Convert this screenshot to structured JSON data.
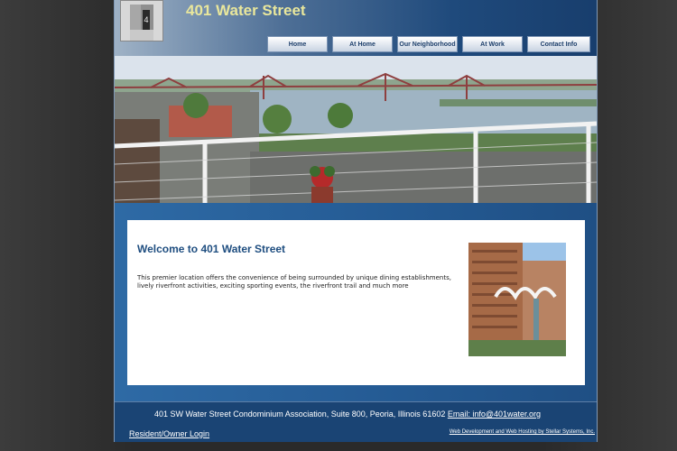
{
  "header": {
    "title": "401 Water Street",
    "logo_icon": "building-tower-icon"
  },
  "nav": {
    "items": [
      {
        "label": "Home"
      },
      {
        "label": "At Home"
      },
      {
        "label": "Our Neighborhood"
      },
      {
        "label": "At Work"
      },
      {
        "label": "Contact Info"
      }
    ]
  },
  "hero": {
    "description_icon": "river-bridge-photo"
  },
  "main": {
    "heading": "Welcome to 401 Water Street",
    "body": "This premier location offers the convenience of being surrounded by unique dining establishments, lively riverfront activities, exciting sporting events, the riverfront trail and much more"
  },
  "footer": {
    "address": "401 SW Water Street Condominium Association, Suite 800, Peoria, Illinois 61602",
    "email_link": "Email: info@401water.org",
    "login_link": "Resident/Owner Login",
    "credit_link": "Web Development and Web Hosting by Stellar Systems, Inc."
  },
  "colors": {
    "title": "#e9e79c",
    "frame": "#1b3f6e",
    "heading": "#1f4e80"
  }
}
